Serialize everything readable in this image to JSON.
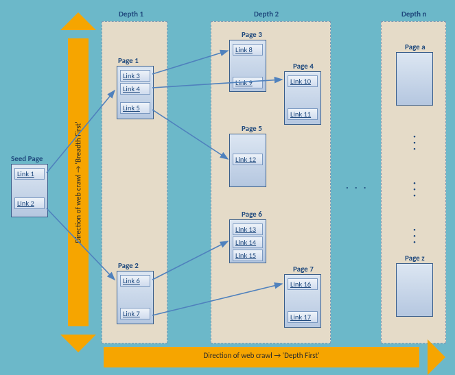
{
  "depthLabels": {
    "d1": "Depth 1",
    "d2": "Depth 2",
    "dn": "Depth n"
  },
  "arrows": {
    "breadth": "Direction of web crawl → 'Breadth First'",
    "depth": "Direction of web crawl → 'Depth First'"
  },
  "seed": {
    "label": "Seed Page",
    "links": [
      "Link 1",
      "Link 2"
    ]
  },
  "pages": {
    "p1": {
      "title": "Page 1",
      "links": [
        "Link 3",
        "Link 4",
        "Link 5"
      ]
    },
    "p2": {
      "title": "Page 2",
      "links": [
        "Link 6",
        "Link 7"
      ]
    },
    "p3": {
      "title": "Page 3",
      "links": [
        "Link 8",
        "Link 9"
      ]
    },
    "p4": {
      "title": "Page 4",
      "links": [
        "Link 10",
        "Link 11"
      ]
    },
    "p5": {
      "title": "Page 5",
      "links": [
        "Link 12"
      ]
    },
    "p6": {
      "title": "Page 6",
      "links": [
        "Link 13",
        "Link 14",
        "Link 15"
      ]
    },
    "p7": {
      "title": "Page 7",
      "links": [
        "Link 16",
        "Link 17"
      ]
    },
    "pa": {
      "title": "Page a"
    },
    "pz": {
      "title": "Page z"
    }
  },
  "ellipsis": ". . .",
  "vellipsis": "·\n·\n·"
}
